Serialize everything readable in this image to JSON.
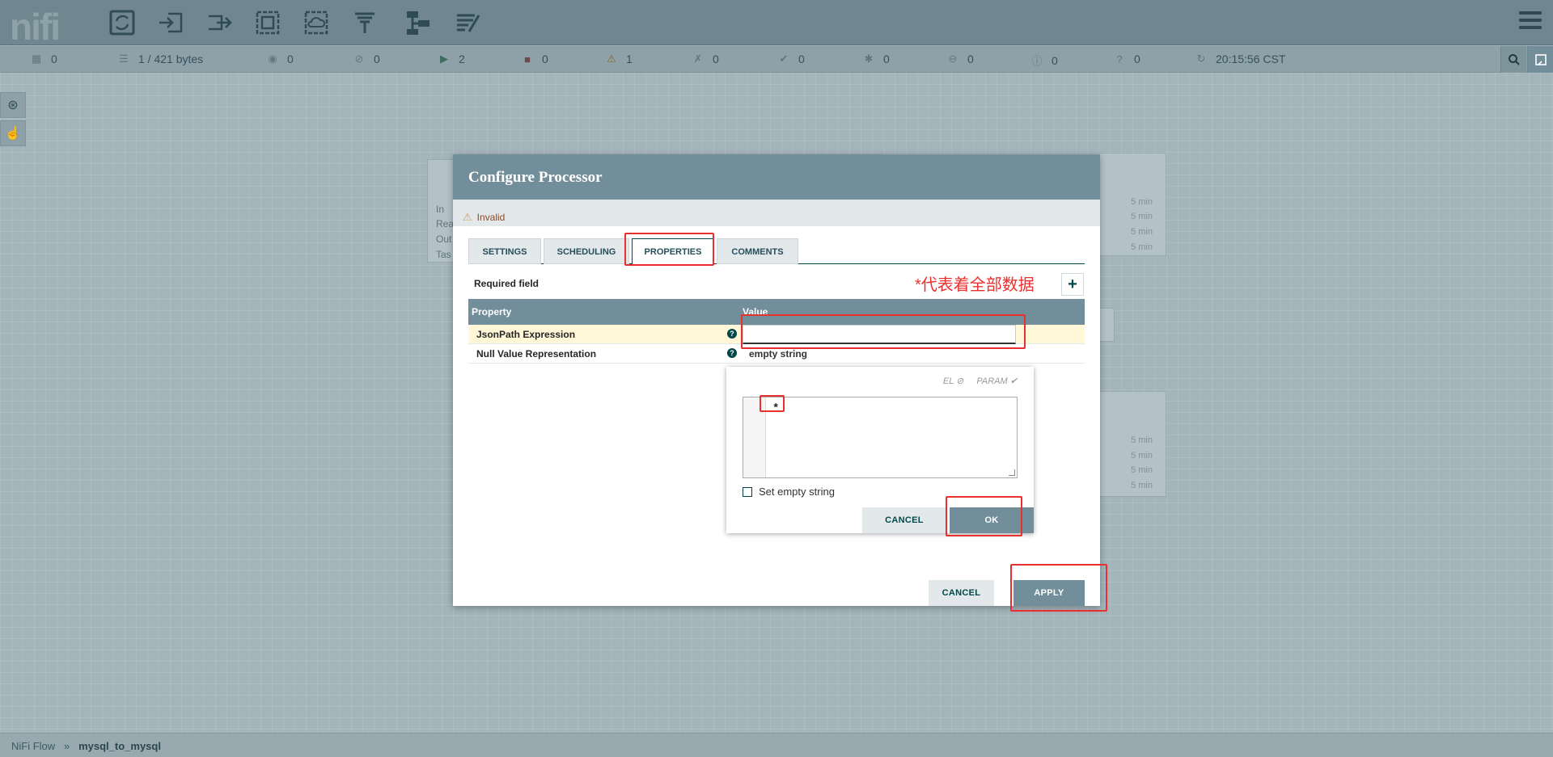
{
  "header": {
    "logo": "nifi",
    "toolbar": [
      {
        "name": "processor-icon"
      },
      {
        "name": "input-port-icon"
      },
      {
        "name": "output-port-icon"
      },
      {
        "name": "process-group-icon"
      },
      {
        "name": "remote-process-group-icon"
      },
      {
        "name": "funnel-icon"
      },
      {
        "name": "template-icon"
      },
      {
        "name": "label-icon"
      }
    ]
  },
  "status": {
    "cluster": "0",
    "queued": "1 / 421 bytes",
    "transmitting": "0",
    "not_transmitting": "0",
    "running": "2",
    "stopped": "0",
    "invalid": "1",
    "disabled": "0",
    "up_to_date": "0",
    "locally_modified": "0",
    "stale": "0",
    "locally_modified_stale": "0",
    "sync_failure": "0",
    "time": "20:15:56 CST"
  },
  "canvas": {
    "ghost_left_labels": [
      "In",
      "Rea",
      "Out",
      "Tas"
    ],
    "ghost_time": "5 min"
  },
  "dialog": {
    "title": "Configure Processor",
    "invalid_label": "Invalid",
    "tabs": [
      "SETTINGS",
      "SCHEDULING",
      "PROPERTIES",
      "COMMENTS"
    ],
    "required_field": "Required field",
    "annotation": "*代表着全部数据",
    "columns": {
      "property": "Property",
      "value": "Value"
    },
    "rows": [
      {
        "property": "JsonPath Expression",
        "value": ""
      },
      {
        "property": "Null Value Representation",
        "value": "empty string"
      }
    ],
    "cancel_label": "CANCEL",
    "apply_label": "APPLY"
  },
  "editor": {
    "el_label": "EL",
    "param_label": "PARAM",
    "text": "*",
    "set_empty_label": "Set empty string",
    "cancel_label": "CANCEL",
    "ok_label": "OK"
  },
  "footer": {
    "root": "NiFi Flow",
    "separator": "»",
    "current": "mysql_to_mysql"
  },
  "colors": {
    "header": "#70878f",
    "dialog_header": "#728e9b",
    "annotation": "#e8312f",
    "accent": "#004849"
  }
}
